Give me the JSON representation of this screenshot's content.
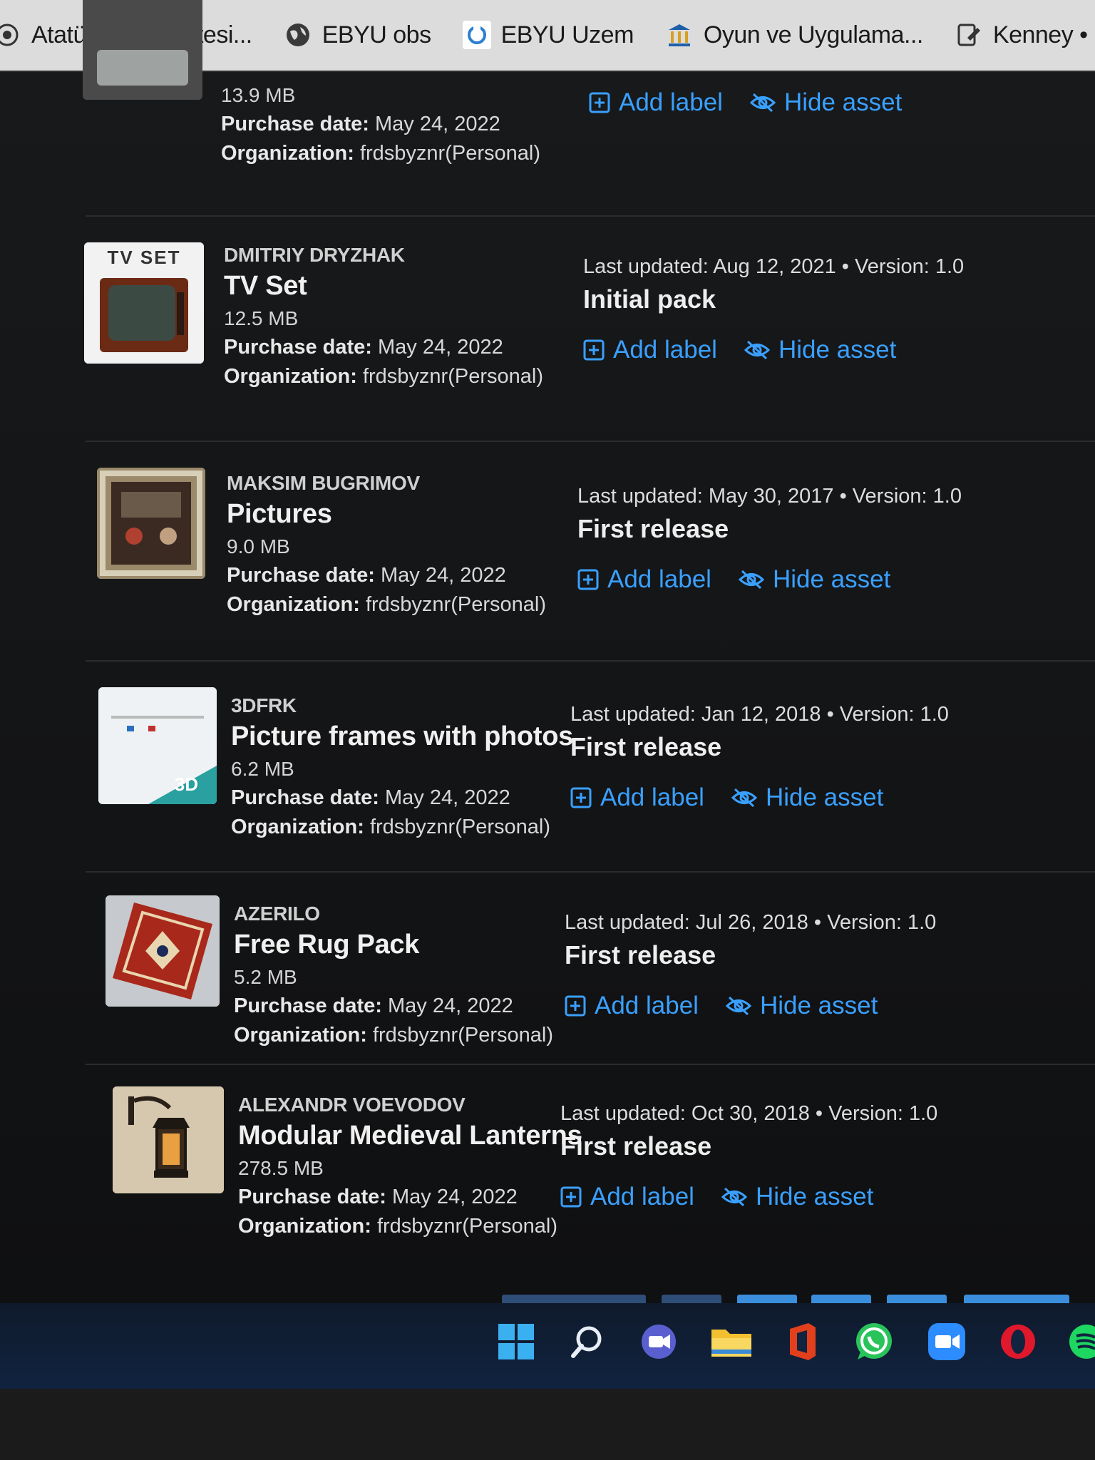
{
  "bookmarks": [
    {
      "label": "Atatürk Üniversitesi...",
      "icon": "globe-circle-icon"
    },
    {
      "label": "EBYU obs",
      "icon": "globe-icon"
    },
    {
      "label": "EBYU Uzem",
      "icon": "uzem-icon"
    },
    {
      "label": "Oyun ve Uygulama...",
      "icon": "building-icon"
    },
    {
      "label": "Kenney • Ho",
      "icon": "kenney-icon"
    }
  ],
  "actions": {
    "add_label": "Add label",
    "hide_asset": "Hide asset"
  },
  "purchase_label": "Purchase date:",
  "organization_label": "Organization:",
  "assets": [
    {
      "publisher": "",
      "title": "",
      "size": "13.9 MB",
      "purchase_date": "May 24, 2022",
      "organization": "frdsbyznr(Personal)",
      "updated": "",
      "notes": "",
      "thumb": "tv-partial"
    },
    {
      "publisher": "DMITRIY DRYZHAK",
      "title": "TV Set",
      "size": "12.5 MB",
      "purchase_date": "May 24, 2022",
      "organization": "frdsbyznr(Personal)",
      "updated": "Last updated: Aug 12, 2021 • Version: 1.0",
      "notes": "Initial pack",
      "thumb": "tv-set",
      "thumb_text": "TV SET"
    },
    {
      "publisher": "MAKSIM BUGRIMOV",
      "title": "Pictures",
      "size": "9.0 MB",
      "purchase_date": "May 24, 2022",
      "organization": "frdsbyznr(Personal)",
      "updated": "Last updated: May 30, 2017 • Version: 1.0",
      "notes": "First release",
      "thumb": "framed-picture"
    },
    {
      "publisher": "3DFRK",
      "title": "Picture frames with photos",
      "size": "6.2 MB",
      "purchase_date": "May 24, 2022",
      "organization": "frdsbyznr(Personal)",
      "updated": "Last updated: Jan 12, 2018 • Version: 1.0",
      "notes": "First release",
      "thumb": "picture-frames",
      "thumb_text": "3D"
    },
    {
      "publisher": "AZERILO",
      "title": "Free Rug Pack",
      "size": "5.2 MB",
      "purchase_date": "May 24, 2022",
      "organization": "frdsbyznr(Personal)",
      "updated": "Last updated: Jul 26, 2018 • Version: 1.0",
      "notes": "First release",
      "thumb": "rug"
    },
    {
      "publisher": "ALEXANDR VOEVODOV",
      "title": "Modular Medieval Lanterns",
      "size": "278.5 MB",
      "purchase_date": "May 24, 2022",
      "organization": "frdsbyznr(Personal)",
      "updated": "Last updated: Oct 30, 2018 • Version: 1.0",
      "notes": "First release",
      "thumb": "lantern"
    }
  ],
  "taskbar": [
    "windows-start-icon",
    "search-icon",
    "chat-icon",
    "file-explorer-icon",
    "office-icon",
    "whatsapp-icon",
    "zoom-icon",
    "opera-icon",
    "spotify-icon"
  ],
  "colors": {
    "link": "#3aa0ff",
    "page_bg": "#141517",
    "bookmarks_bg": "#dcdcdc",
    "taskbar_bg": "#10233f"
  }
}
